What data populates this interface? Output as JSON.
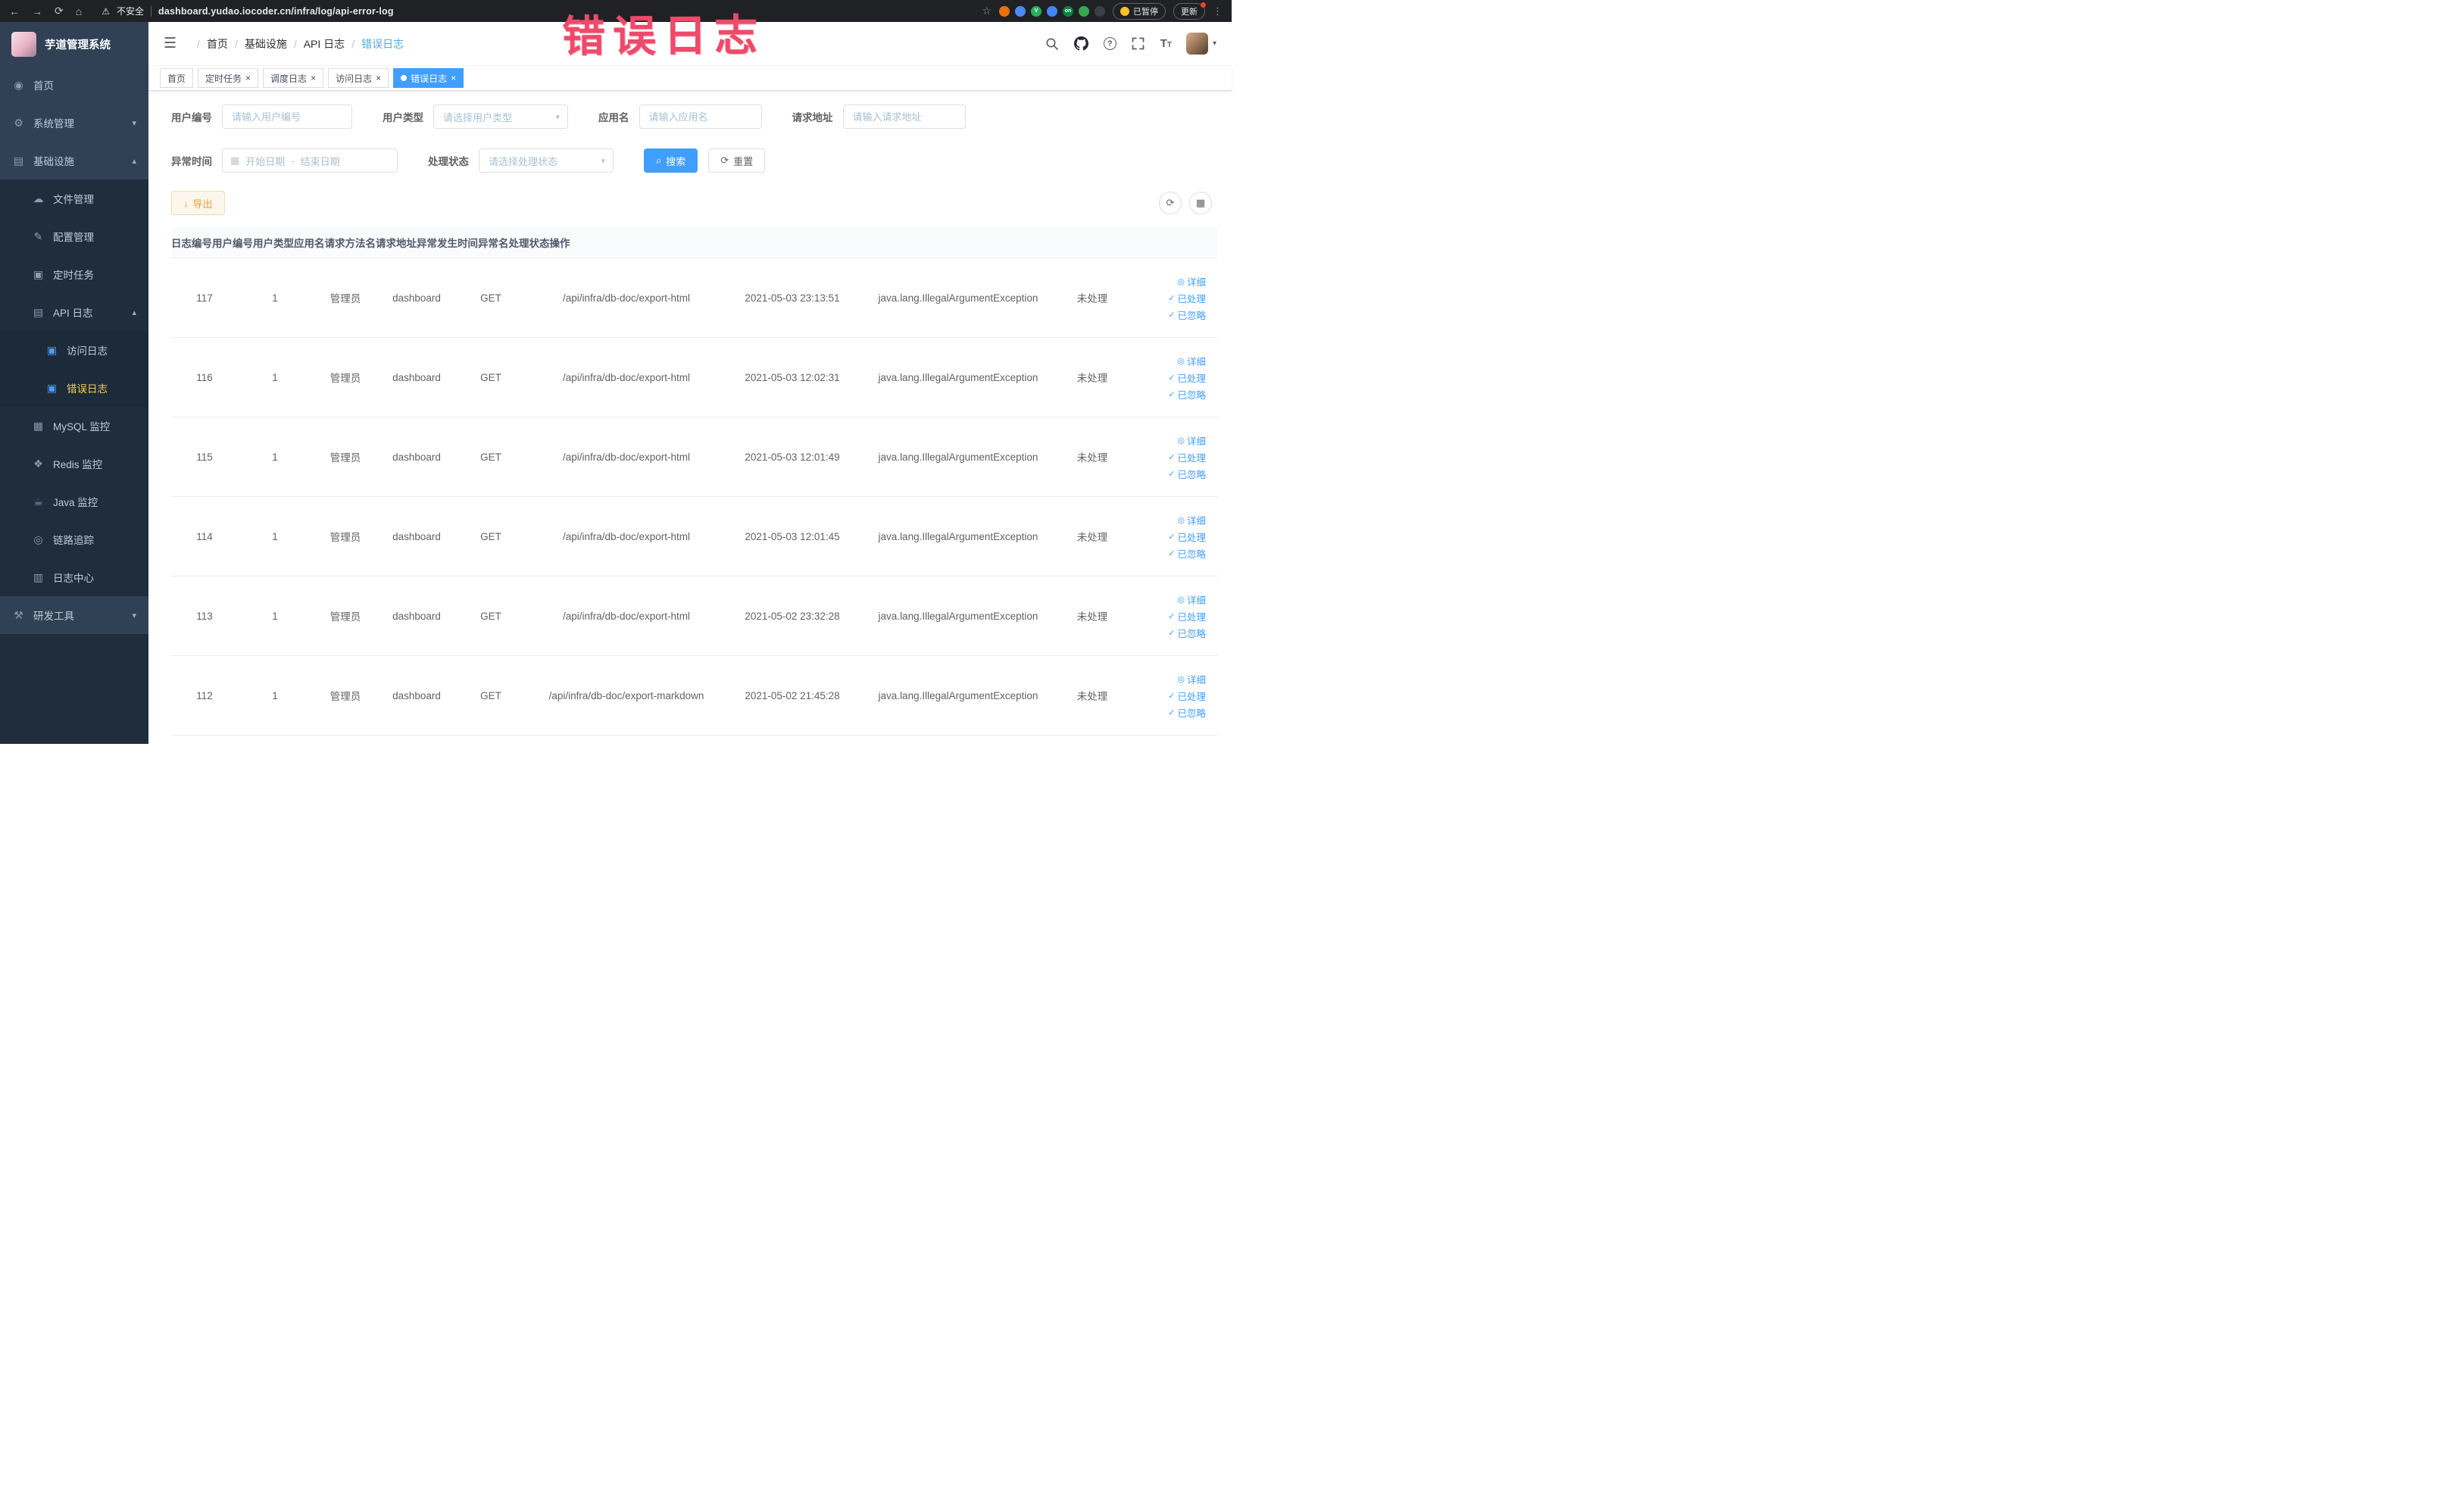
{
  "ui": {
    "back_glyph": "←",
    "forward_glyph": "→",
    "reload_glyph": "⟳",
    "home_glyph": "⌂",
    "warn_glyph": "⚠",
    "star_glyph": "☆",
    "kebab_glyph": "⋮",
    "breadcrumb_sep": "/",
    "hamburger_glyph": "☰",
    "caret_down": "▾",
    "select_caret": "▾",
    "calendar_glyph": "▦",
    "range_separator": "-",
    "search_btn_glyph": "⌕",
    "reset_btn_glyph": "⟳",
    "export_glyph": "↓",
    "refresh_circle_glyph": "⟳",
    "grid_circle_glyph": "▦",
    "tag_close_glyph": "×",
    "question_glyph": "?",
    "font_size_glyph_big": "T",
    "font_size_glyph_small": "T"
  },
  "browser": {
    "security": "不安全",
    "url": "dashboard.yudao.iocoder.cn/infra/log/api-error-log",
    "extensions": [
      {
        "name": "extension-orange",
        "color": "#e8710a",
        "label": ""
      },
      {
        "name": "extension-drop",
        "color": "#4c8bf5",
        "label": ""
      },
      {
        "name": "extension-green-check",
        "color": "#27ae60",
        "label": "V"
      },
      {
        "name": "extension-blue-grid",
        "color": "#4285f4",
        "label": ""
      },
      {
        "name": "extension-on-badge",
        "color": "#0b8043",
        "label": "on"
      },
      {
        "name": "extension-leaf",
        "color": "#34a853",
        "label": ""
      },
      {
        "name": "extension-paw",
        "color": "#3c4043",
        "label": ""
      }
    ],
    "paused_label": "已暂停",
    "update_label": "更新"
  },
  "annotation": "错误日志",
  "sidebar": {
    "title": "芋道管理系统",
    "items": [
      {
        "label": "首页",
        "icon": "◉",
        "icon_name": "home-icon",
        "level": 1
      },
      {
        "label": "系统管理",
        "icon": "⚙",
        "icon_name": "gear-icon",
        "level": 1,
        "chevron": "▾"
      },
      {
        "label": "基础设施",
        "icon": "▤",
        "icon_name": "infrastructure-icon",
        "level": 1,
        "chevron": "▴"
      },
      {
        "label": "文件管理",
        "icon": "☁",
        "icon_name": "file-manage-icon",
        "level": 2
      },
      {
        "label": "配置管理",
        "icon": "✎",
        "icon_name": "config-manage-icon",
        "level": 2
      },
      {
        "label": "定时任务",
        "icon": "▣",
        "icon_name": "scheduled-job-icon",
        "level": 2
      },
      {
        "label": "API 日志",
        "icon": "▤",
        "icon_name": "api-log-icon",
        "level": 2,
        "chevron": "▴"
      },
      {
        "label": "访问日志",
        "icon": "▣",
        "icon_name": "access-log-icon",
        "level": 3,
        "blueicon": true
      },
      {
        "label": "错误日志",
        "icon": "▣",
        "icon_name": "error-log-icon",
        "level": 3,
        "blueicon": true,
        "active": true
      },
      {
        "label": "MySQL 监控",
        "icon": "▦",
        "icon_name": "mysql-monitor-icon",
        "level": 2
      },
      {
        "label": "Redis 监控",
        "icon": "❖",
        "icon_name": "redis-monitor-icon",
        "level": 2
      },
      {
        "label": "Java 监控",
        "icon": "☕",
        "icon_name": "java-monitor-icon",
        "level": 2
      },
      {
        "label": "链路追踪",
        "icon": "◎",
        "icon_name": "trace-icon",
        "level": 2
      },
      {
        "label": "日志中心",
        "icon": "▥",
        "icon_name": "log-center-icon",
        "level": 2
      },
      {
        "label": "研发工具",
        "icon": "⚒",
        "icon_name": "dev-tools-icon",
        "level": 1,
        "chevron": "▾"
      }
    ]
  },
  "header": {
    "breadcrumbs": [
      "首页",
      "基础设施",
      "API 日志",
      "错误日志"
    ]
  },
  "tabs": [
    {
      "label": "首页"
    },
    {
      "label": "定时任务",
      "closable": true
    },
    {
      "label": "调度日志",
      "closable": true
    },
    {
      "label": "访问日志",
      "closable": true
    },
    {
      "label": "错误日志",
      "closable": true,
      "active": true
    }
  ],
  "filters": {
    "user_id": {
      "label": "用户编号",
      "placeholder": "请输入用户编号",
      "value": ""
    },
    "user_type": {
      "label": "用户类型",
      "placeholder": "请选择用户类型"
    },
    "app_name": {
      "label": "应用名",
      "placeholder": "请输入应用名",
      "value": ""
    },
    "request_url": {
      "label": "请求地址",
      "placeholder": "请输入请求地址",
      "value": ""
    },
    "exception_time": {
      "label": "异常时间",
      "start_placeholder": "开始日期",
      "end_placeholder": "结束日期"
    },
    "process_status": {
      "label": "处理状态",
      "placeholder": "请选择处理状态"
    },
    "search_label": "搜索",
    "reset_label": "重置"
  },
  "toolbar": {
    "export_label": "导出"
  },
  "table": {
    "columns": [
      "日志编号",
      "用户编号",
      "用户类型",
      "应用名",
      "请求方法名",
      "请求地址",
      "异常发生时间",
      "异常名",
      "处理状态",
      "操作"
    ],
    "actions": [
      {
        "label": "详细",
        "glyph": "◎",
        "icon_name": "eye-icon"
      },
      {
        "label": "已处理",
        "glyph": "✓",
        "icon_name": "check-icon"
      },
      {
        "label": "已忽略",
        "glyph": "✓",
        "icon_name": "check-icon"
      }
    ],
    "rows": [
      {
        "id": "117",
        "user_id": "1",
        "user_type": "管理员",
        "app": "dashboard",
        "method": "GET",
        "url": "/api/infra/db-doc/export-html",
        "time": "2021-05-03 23:13:51",
        "exception": "java.lang.IllegalArgumentException",
        "status": "未处理"
      },
      {
        "id": "116",
        "user_id": "1",
        "user_type": "管理员",
        "app": "dashboard",
        "method": "GET",
        "url": "/api/infra/db-doc/export-html",
        "time": "2021-05-03 12:02:31",
        "exception": "java.lang.IllegalArgumentException",
        "status": "未处理"
      },
      {
        "id": "115",
        "user_id": "1",
        "user_type": "管理员",
        "app": "dashboard",
        "method": "GET",
        "url": "/api/infra/db-doc/export-html",
        "time": "2021-05-03 12:01:49",
        "exception": "java.lang.IllegalArgumentException",
        "status": "未处理"
      },
      {
        "id": "114",
        "user_id": "1",
        "user_type": "管理员",
        "app": "dashboard",
        "method": "GET",
        "url": "/api/infra/db-doc/export-html",
        "time": "2021-05-03 12:01:45",
        "exception": "java.lang.IllegalArgumentException",
        "status": "未处理"
      },
      {
        "id": "113",
        "user_id": "1",
        "user_type": "管理员",
        "app": "dashboard",
        "method": "GET",
        "url": "/api/infra/db-doc/export-html",
        "time": "2021-05-02 23:32:28",
        "exception": "java.lang.IllegalArgumentException",
        "status": "未处理"
      },
      {
        "id": "112",
        "user_id": "1",
        "user_type": "管理员",
        "app": "dashboard",
        "method": "GET",
        "url": "/api/infra/db-doc/export-markdown",
        "time": "2021-05-02 21:45:28",
        "exception": "java.lang.IllegalArgumentException",
        "status": "未处理"
      }
    ]
  }
}
